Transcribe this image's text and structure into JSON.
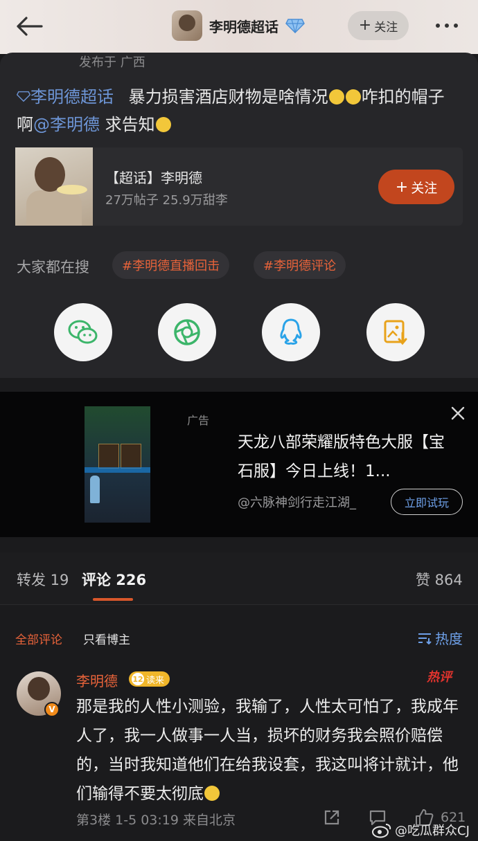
{
  "header": {
    "title": "李明德超话",
    "follow_label": "关注",
    "icons": [
      "back-arrow-icon",
      "diamond-icon",
      "more-icon"
    ]
  },
  "post": {
    "published": "发布于 广西",
    "topic_link": "李明德超话",
    "text_part1": "暴力损害酒店财物是啥情况",
    "text_part2": "咋扣的帽子啊",
    "mention": "@李明德",
    "text_part3": " 求告知",
    "topic_card": {
      "name": "【超话】李明德",
      "stats": "27万帖子 25.9万甜李",
      "follow_label": "关注"
    },
    "search_label": "大家都在搜",
    "tags": [
      "#李明德直播回击",
      "#李明德评论"
    ],
    "share_icons": [
      "wechat-icon",
      "moments-icon",
      "qq-icon",
      "save-image-icon"
    ]
  },
  "ad": {
    "label": "广告",
    "title": "天龙八部荣耀版特色大服【宝石服】今日上线！1...",
    "source": "@六脉神剑行走江湖_",
    "cta": "立即试玩"
  },
  "tabs": {
    "repost": "转发 19",
    "comments": "评论 226",
    "likes": "赞 864"
  },
  "filters": {
    "all": "全部评论",
    "author_only": "只看博主",
    "sort": "热度"
  },
  "comment": {
    "author": "李明德",
    "level": "12",
    "level_tag": "读来",
    "hot_label": "热评",
    "text": "那是我的人性小测验，我输了，人性太可怕了，我成年人了，我一人做事一人当，损坏的财务我会照价赔偿的，当时我知道他们在给我设套，我这叫将计就计，他们输得不要太彻底",
    "meta": "第3楼 1-5 03:19 来自北京",
    "like_count": "621"
  },
  "watermark": "@吃瓜群众CJ",
  "colors": {
    "accent": "#e8633a",
    "link": "#6d95d6",
    "follow_button": "#c2461e"
  }
}
